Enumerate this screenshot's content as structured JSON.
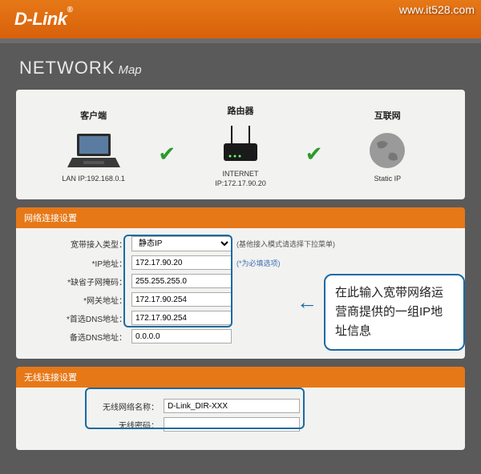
{
  "watermark": "www.it528.com",
  "logo": "D-Link",
  "pageTitle": {
    "net": "NETWORK",
    "map": "Map"
  },
  "topology": {
    "client": {
      "title": "客户端",
      "ip": "LAN IP:192.168.0.1"
    },
    "router": {
      "title": "路由器",
      "line1": "INTERNET",
      "line2": "IP:172.17.90.20"
    },
    "internet": {
      "title": "互联网",
      "mode": "Static IP"
    }
  },
  "section1": {
    "title": "网络连接设置",
    "rows": {
      "accessType": {
        "label": "宽带接入类型：",
        "value": "静态IP",
        "note": "(基他接入模式请选择下拉菜单)"
      },
      "ip": {
        "label": "*IP地址：",
        "value": "172.17.90.20",
        "note": "(*为必填选项)"
      },
      "mask": {
        "label": "*缺省子网掩码：",
        "value": "255.255.255.0"
      },
      "gateway": {
        "label": "*网关地址：",
        "value": "172.17.90.254"
      },
      "dns1": {
        "label": "*首选DNS地址：",
        "value": "172.17.90.254"
      },
      "dns2": {
        "label": "备选DNS地址：",
        "value": "0.0.0.0"
      }
    }
  },
  "section2": {
    "title": "无线连接设置",
    "rows": {
      "ssid": {
        "label": "无线网络名称：",
        "value": "D-Link_DIR-XXX"
      },
      "pwd": {
        "label": "无线密码：",
        "value": ""
      }
    }
  },
  "callout": "在此输入宽带网络运营商提供的一组IP地址信息"
}
